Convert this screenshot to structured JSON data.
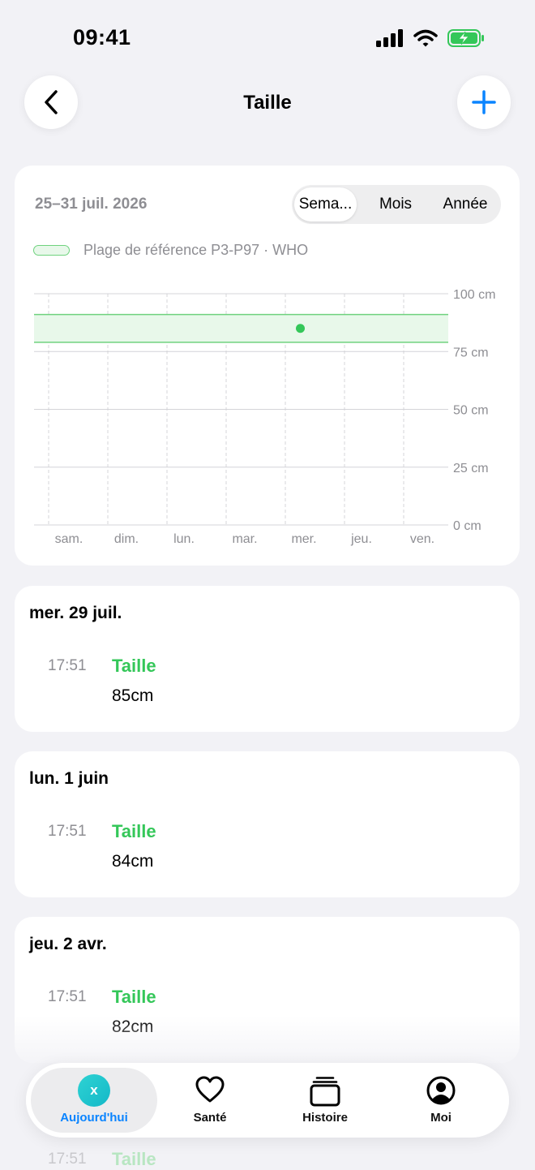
{
  "status": {
    "time": "09:41",
    "icons": [
      "signal-icon",
      "wifi-icon",
      "battery-charging-icon"
    ]
  },
  "nav": {
    "title": "Taille",
    "back_icon": "chevron-left-icon",
    "add_icon": "plus-icon"
  },
  "colors": {
    "accent": "#0a84ff",
    "green": "#34c759",
    "band": "#e8f8ea",
    "teal": "#14b8c8"
  },
  "range": {
    "label": "25–31 juil. 2026",
    "tabs": [
      "Sema...",
      "Mois",
      "Année"
    ],
    "selected": "Sema..."
  },
  "legend": {
    "text": "Plage de référence P3-P97 · WHO"
  },
  "chart_data": {
    "type": "scatter",
    "categories": [
      "sam.",
      "dim.",
      "lun.",
      "mar.",
      "mer.",
      "jeu.",
      "ven."
    ],
    "y_ticks": [
      "100 cm",
      "75 cm",
      "50 cm",
      "25 cm",
      "0 cm"
    ],
    "y_tick_values": [
      100,
      75,
      50,
      25,
      0
    ],
    "ylim": [
      0,
      100
    ],
    "reference_band": [
      79,
      91
    ],
    "points": [
      {
        "x": "mer.",
        "y": 85
      }
    ],
    "grid": true
  },
  "entries": [
    {
      "date": "mer. 29 juil.",
      "time": "17:51",
      "label": "Taille",
      "value": "85cm"
    },
    {
      "date": "lun. 1 juin",
      "time": "17:51",
      "label": "Taille",
      "value": "84cm"
    },
    {
      "date": "jeu. 2 avr.",
      "time": "17:51",
      "label": "Taille",
      "value": "82cm"
    }
  ],
  "peek": {
    "time": "17:51",
    "label": "Taille"
  },
  "tabbar": {
    "items": [
      {
        "label": "Aujourd'hui",
        "icon": "today-badge-icon",
        "badge": "x",
        "active": true
      },
      {
        "label": "Santé",
        "icon": "heart-icon"
      },
      {
        "label": "Histoire",
        "icon": "stack-icon"
      },
      {
        "label": "Moi",
        "icon": "person-circle-icon"
      }
    ]
  }
}
